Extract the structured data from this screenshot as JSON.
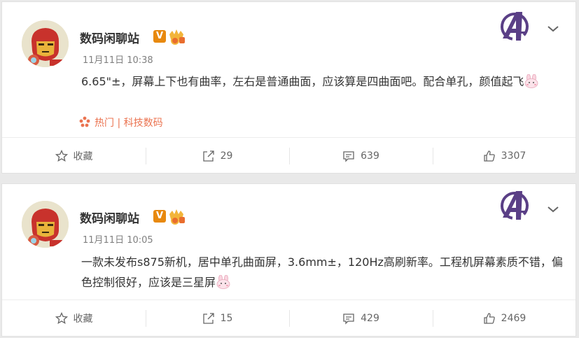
{
  "posts": [
    {
      "author": "数码闲聊站",
      "verified_badge": "V",
      "time": "11月11日 10:38",
      "content": "6.65\"±，屏幕上下也有曲率，左右是普通曲面，应该算是四曲面吧。配合单孔，颜值起飞",
      "topic": "热门 | 科技数码",
      "actions": {
        "favorite": "收藏",
        "repost": "29",
        "comment": "639",
        "like": "3307"
      }
    },
    {
      "author": "数码闲聊站",
      "verified_badge": "V",
      "time": "11月11日 10:05",
      "content": "一款未发布s875新机，居中单孔曲面屏，3.6mm±，120Hz高刷新率。工程机屏幕素质不错，偏色控制很好，应该是三星屏",
      "actions": {
        "favorite": "收藏",
        "repost": "15",
        "comment": "429",
        "like": "2469"
      }
    }
  ],
  "icons": {
    "favorite": "star-icon",
    "repost": "share-icon",
    "comment": "comment-icon",
    "like": "thumbs-up-icon",
    "menu": "chevron-down-icon",
    "emoji": "bunny-emoji-icon",
    "topic": "flower-icon",
    "logo": "avengers-logo-icon"
  },
  "colors": {
    "accent_orange": "#eb7350",
    "verified_badge": "#e8890e",
    "logo_purple": "#5a3f86",
    "text": "#333333",
    "muted": "#808080"
  }
}
